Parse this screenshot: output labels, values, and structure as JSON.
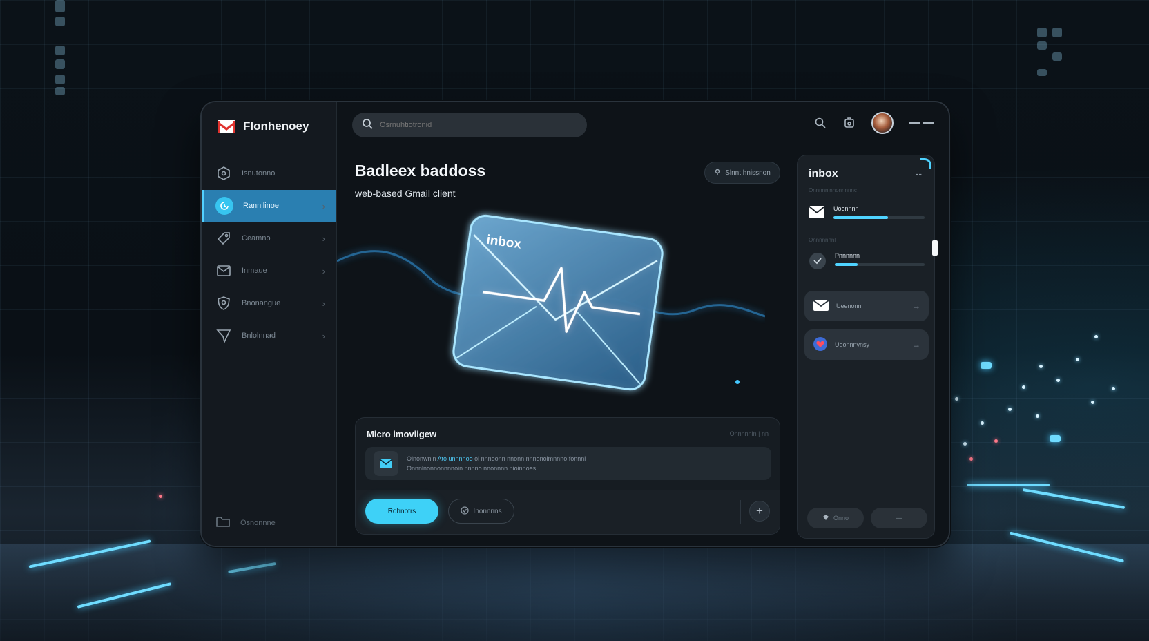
{
  "app": {
    "name": "Flonhenoey"
  },
  "search": {
    "placeholder": "Osrnuhtiotronid"
  },
  "sidebar": {
    "items": [
      {
        "label": "Isnutonno",
        "icon": "hexagon-icon",
        "active": false
      },
      {
        "label": "Rannilinoe",
        "icon": "clock-icon",
        "active": true
      },
      {
        "label": "Ceamno",
        "icon": "tag-icon",
        "active": false
      },
      {
        "label": "Inmaue",
        "icon": "mail-icon",
        "active": false
      },
      {
        "label": "Bnonangue",
        "icon": "shield-icon",
        "active": false
      },
      {
        "label": "Bnlolnnad",
        "icon": "send-icon",
        "active": false
      }
    ],
    "footer_label": "Osnonnne"
  },
  "hero": {
    "title": "Badleex baddoss",
    "subtitle": "web-based Gmail client",
    "button_label": "Slnnt hnissnon",
    "art_label": "inbox"
  },
  "micro": {
    "title": "Micro imoviigew",
    "meta": "Onnnnnln |  nn",
    "line1_prefix": "Olnonwnln ",
    "line1_highlight": "Ato unnnnoo",
    "line1_suffix": " oi nnnoonn nnonn nnnonoimnnno fonnnl",
    "line2": "Onnnlnonnonnnnoin nnnno nnonnnn nioinnoes",
    "primary_label": "Rohnotrs",
    "secondary_label": "Inonnnns",
    "plus_label": "+"
  },
  "right_panel": {
    "title": "inbox",
    "dash": "--",
    "caption1": "Onnnnnlnnonnnnnc",
    "caption2": "Onnnnnnnl",
    "item1_label": "Uoennnn",
    "item1_progress": 0.6,
    "item2_label": "Pnnnnnn",
    "item2_progress": 0.25,
    "card1_label": "Ueenonn",
    "card2_label": "Uoonnnvnsy",
    "foot1_label": "Onno",
    "foot2_label": "---"
  },
  "colors": {
    "accent": "#3ed1f7",
    "active_nav": "#2a7fb1",
    "brand_red": "#e0332f",
    "window_bg": "#0e1318"
  }
}
